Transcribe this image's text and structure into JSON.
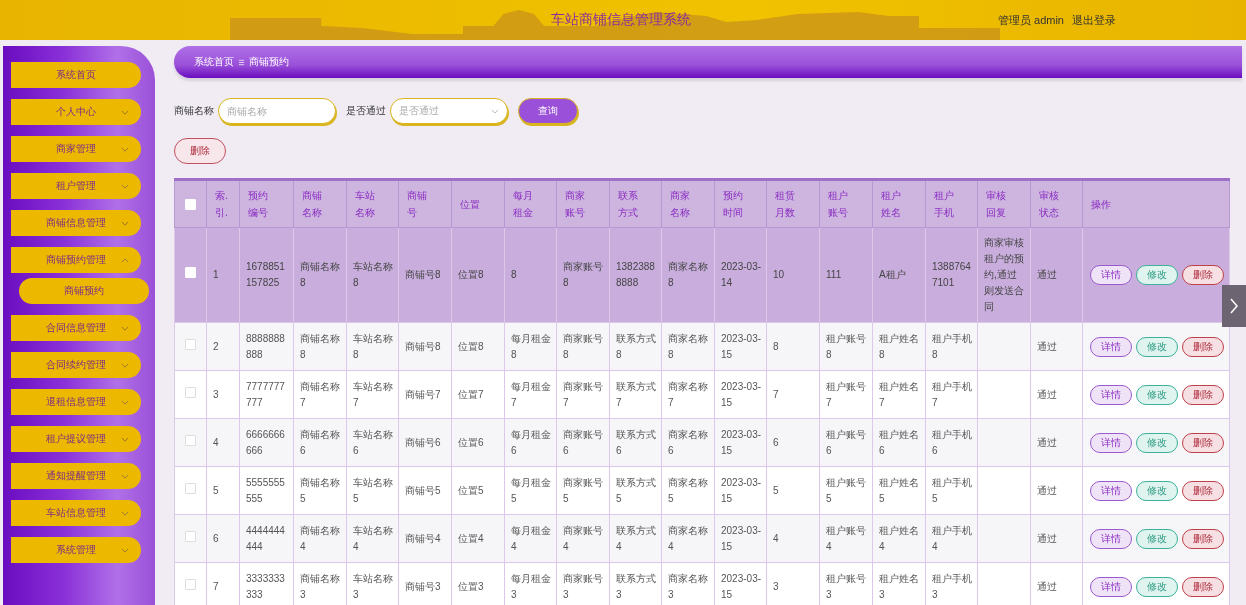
{
  "header": {
    "title": "车站商铺信息管理系统",
    "user": "管理员 admin",
    "logout": "退出登录"
  },
  "sidebar": {
    "items": [
      {
        "label": "系统首页",
        "kind": "link"
      },
      {
        "label": "个人中心",
        "kind": "menu",
        "expanded": false
      },
      {
        "label": "商家管理",
        "kind": "menu",
        "expanded": false
      },
      {
        "label": "租户管理",
        "kind": "menu",
        "expanded": false
      },
      {
        "label": "商铺信息管理",
        "kind": "menu",
        "expanded": false
      },
      {
        "label": "商铺预约管理",
        "kind": "menu",
        "expanded": true,
        "children": [
          {
            "label": "商铺预约"
          }
        ]
      },
      {
        "label": "合同信息管理",
        "kind": "menu",
        "expanded": false
      },
      {
        "label": "合同续约管理",
        "kind": "menu",
        "expanded": false
      },
      {
        "label": "退租信息管理",
        "kind": "menu",
        "expanded": false
      },
      {
        "label": "租户提议管理",
        "kind": "menu",
        "expanded": false
      },
      {
        "label": "通知提醒管理",
        "kind": "menu",
        "expanded": false
      },
      {
        "label": "车站信息管理",
        "kind": "menu",
        "expanded": false
      },
      {
        "label": "系统管理",
        "kind": "menu",
        "expanded": false
      }
    ]
  },
  "breadcrumb": [
    "系统首页",
    "商铺预约"
  ],
  "search": {
    "fields": [
      {
        "label": "商铺名称",
        "kind": "input",
        "placeholder": "商铺名称"
      },
      {
        "label": "是否通过",
        "kind": "select",
        "placeholder": "是否通过"
      }
    ],
    "button": "查询"
  },
  "delete_button": "删除",
  "table": {
    "select_all": {
      "checked": false
    },
    "columns": [
      "索.引.",
      "预约编号",
      "商铺名称",
      "车站名称",
      "商铺号",
      "位置",
      "每月租金",
      "商家账号",
      "联系方式",
      "商家名称",
      "预约时间",
      "租赁月数",
      "租户账号",
      "租户姓名",
      "租户手机",
      "审核回复",
      "审核状态",
      "操作"
    ],
    "rows": [
      {
        "selected": true,
        "cells": [
          "1",
          "1678851157825",
          "商铺名称8",
          "车站名称8",
          "商铺号8",
          "位置8",
          "8",
          "商家账号8",
          "13823888888",
          "商家名称8",
          "2023-03-14",
          "10",
          "111",
          "A租户",
          "13887647101",
          "商家审核租户的预约,通过则发送合同",
          "通过"
        ],
        "actions": [
          "详情",
          "修改",
          "删除"
        ]
      },
      {
        "selected": false,
        "cells": [
          "2",
          "8888888888",
          "商铺名称8",
          "车站名称8",
          "商铺号8",
          "位置8",
          "每月租金8",
          "商家账号8",
          "联系方式8",
          "商家名称8",
          "2023-03-15",
          "8",
          "租户账号8",
          "租户姓名8",
          "租户手机8",
          "",
          "通过"
        ],
        "actions": [
          "详情",
          "修改",
          "删除"
        ]
      },
      {
        "selected": false,
        "cells": [
          "3",
          "7777777777",
          "商铺名称7",
          "车站名称7",
          "商铺号7",
          "位置7",
          "每月租金7",
          "商家账号7",
          "联系方式7",
          "商家名称7",
          "2023-03-15",
          "7",
          "租户账号7",
          "租户姓名7",
          "租户手机7",
          "",
          "通过"
        ],
        "actions": [
          "详情",
          "修改",
          "删除"
        ]
      },
      {
        "selected": false,
        "cells": [
          "4",
          "6666666666",
          "商铺名称6",
          "车站名称6",
          "商铺号6",
          "位置6",
          "每月租金6",
          "商家账号6",
          "联系方式6",
          "商家名称6",
          "2023-03-15",
          "6",
          "租户账号6",
          "租户姓名6",
          "租户手机6",
          "",
          "通过"
        ],
        "actions": [
          "详情",
          "修改",
          "删除"
        ]
      },
      {
        "selected": false,
        "cells": [
          "5",
          "5555555555",
          "商铺名称5",
          "车站名称5",
          "商铺号5",
          "位置5",
          "每月租金5",
          "商家账号5",
          "联系方式5",
          "商家名称5",
          "2023-03-15",
          "5",
          "租户账号5",
          "租户姓名5",
          "租户手机5",
          "",
          "通过"
        ],
        "actions": [
          "详情",
          "修改",
          "删除"
        ]
      },
      {
        "selected": false,
        "cells": [
          "6",
          "4444444444",
          "商铺名称4",
          "车站名称4",
          "商铺号4",
          "位置4",
          "每月租金4",
          "商家账号4",
          "联系方式4",
          "商家名称4",
          "2023-03-15",
          "4",
          "租户账号4",
          "租户姓名4",
          "租户手机4",
          "",
          "通过"
        ],
        "actions": [
          "详情",
          "修改",
          "删除"
        ]
      },
      {
        "selected": false,
        "cells": [
          "7",
          "3333333333",
          "商铺名称3",
          "车站名称3",
          "商铺号3",
          "位置3",
          "每月租金3",
          "商家账号3",
          "联系方式3",
          "商家名称3",
          "2023-03-15",
          "3",
          "租户账号3",
          "租户姓名3",
          "租户手机3",
          "",
          "通过"
        ],
        "actions": [
          "详情",
          "修改",
          "删除"
        ]
      }
    ]
  }
}
